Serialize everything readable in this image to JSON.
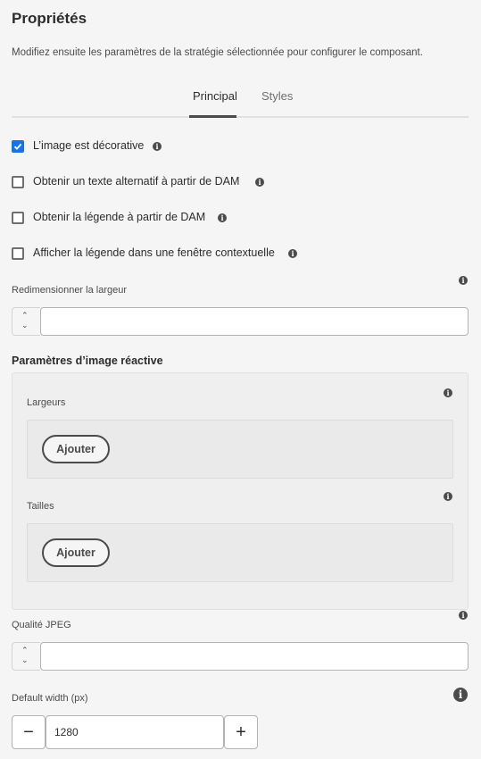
{
  "header": {
    "title": "Propriétés",
    "description": "Modifiez ensuite les paramètres de la stratégie sélectionnée pour configurer le composant."
  },
  "tabs": [
    {
      "label": "Principal",
      "active": true
    },
    {
      "label": "Styles",
      "active": false
    }
  ],
  "checkboxes": [
    {
      "label": "L’image est décorative",
      "checked": true
    },
    {
      "label": "Obtenir un texte alternatif à partir de DAM",
      "checked": false
    },
    {
      "label": "Obtenir la légende à partir de DAM",
      "checked": false
    },
    {
      "label": "Afficher la légende dans une fenêtre contextuelle",
      "checked": false
    }
  ],
  "resize_width": {
    "label": "Redimensionner la largeur",
    "value": ""
  },
  "responsive": {
    "title": "Paramètres d’image réactive",
    "widths": {
      "label": "Largeurs",
      "add_label": "Ajouter"
    },
    "sizes": {
      "label": "Tailles",
      "add_label": "Ajouter"
    }
  },
  "jpeg_quality": {
    "label": "Qualité JPEG",
    "value": ""
  },
  "default_width": {
    "label": "Default width (px)",
    "value": "1280",
    "minus": "−",
    "plus": "+"
  },
  "icons": {
    "info": "i",
    "stepper_up": "⌃",
    "stepper_down": "⌄"
  },
  "colors": {
    "accent": "#1473e6",
    "background": "#f5f5f5"
  }
}
